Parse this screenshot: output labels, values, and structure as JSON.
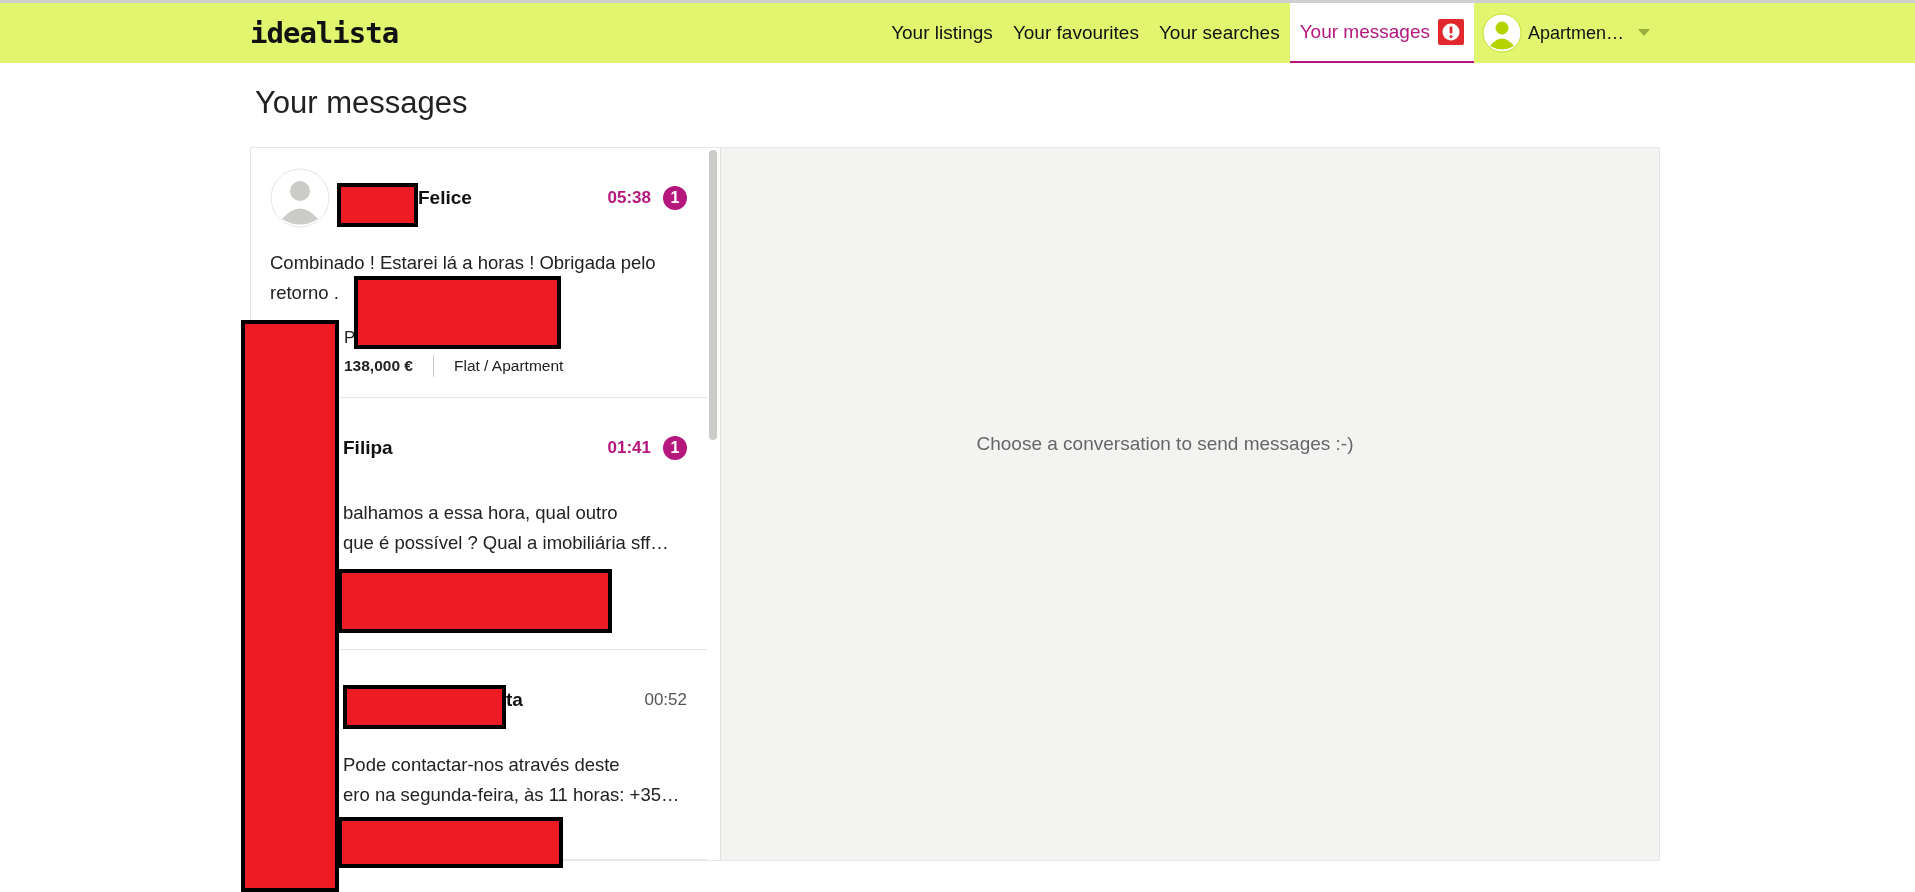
{
  "header": {
    "logo": "idealista",
    "nav": [
      {
        "label": "Your listings",
        "selected": false,
        "alert": false
      },
      {
        "label": "Your favourites",
        "selected": false,
        "alert": false
      },
      {
        "label": "Your searches",
        "selected": false,
        "alert": false
      },
      {
        "label": "Your messages",
        "selected": true,
        "alert": true
      }
    ],
    "account": {
      "label": "Apartmen…"
    }
  },
  "page_title": "Your messages",
  "conversations": [
    {
      "name": "Felice",
      "time": "05:38",
      "unread": "1",
      "preview": [
        "Combinado ! Estarei lá a horas ! Obrigada pelo",
        "retorno ."
      ],
      "detail": "P",
      "price": "138,000 €",
      "property_type": "Flat / Apartment"
    },
    {
      "name": "Filipa",
      "time": "01:41",
      "unread": "1",
      "preview": [
        "balhamos a essa hora, qual outro",
        "que é possível ? Qual a imobiliária sff…"
      ]
    },
    {
      "name": "ta",
      "time": "00:52",
      "preview": [
        "Pode contactar-nos através deste",
        "ero na segunda-feira, às 11 horas: +35…"
      ]
    }
  ],
  "empty_state": "Choose a conversation to send messages :-)"
}
